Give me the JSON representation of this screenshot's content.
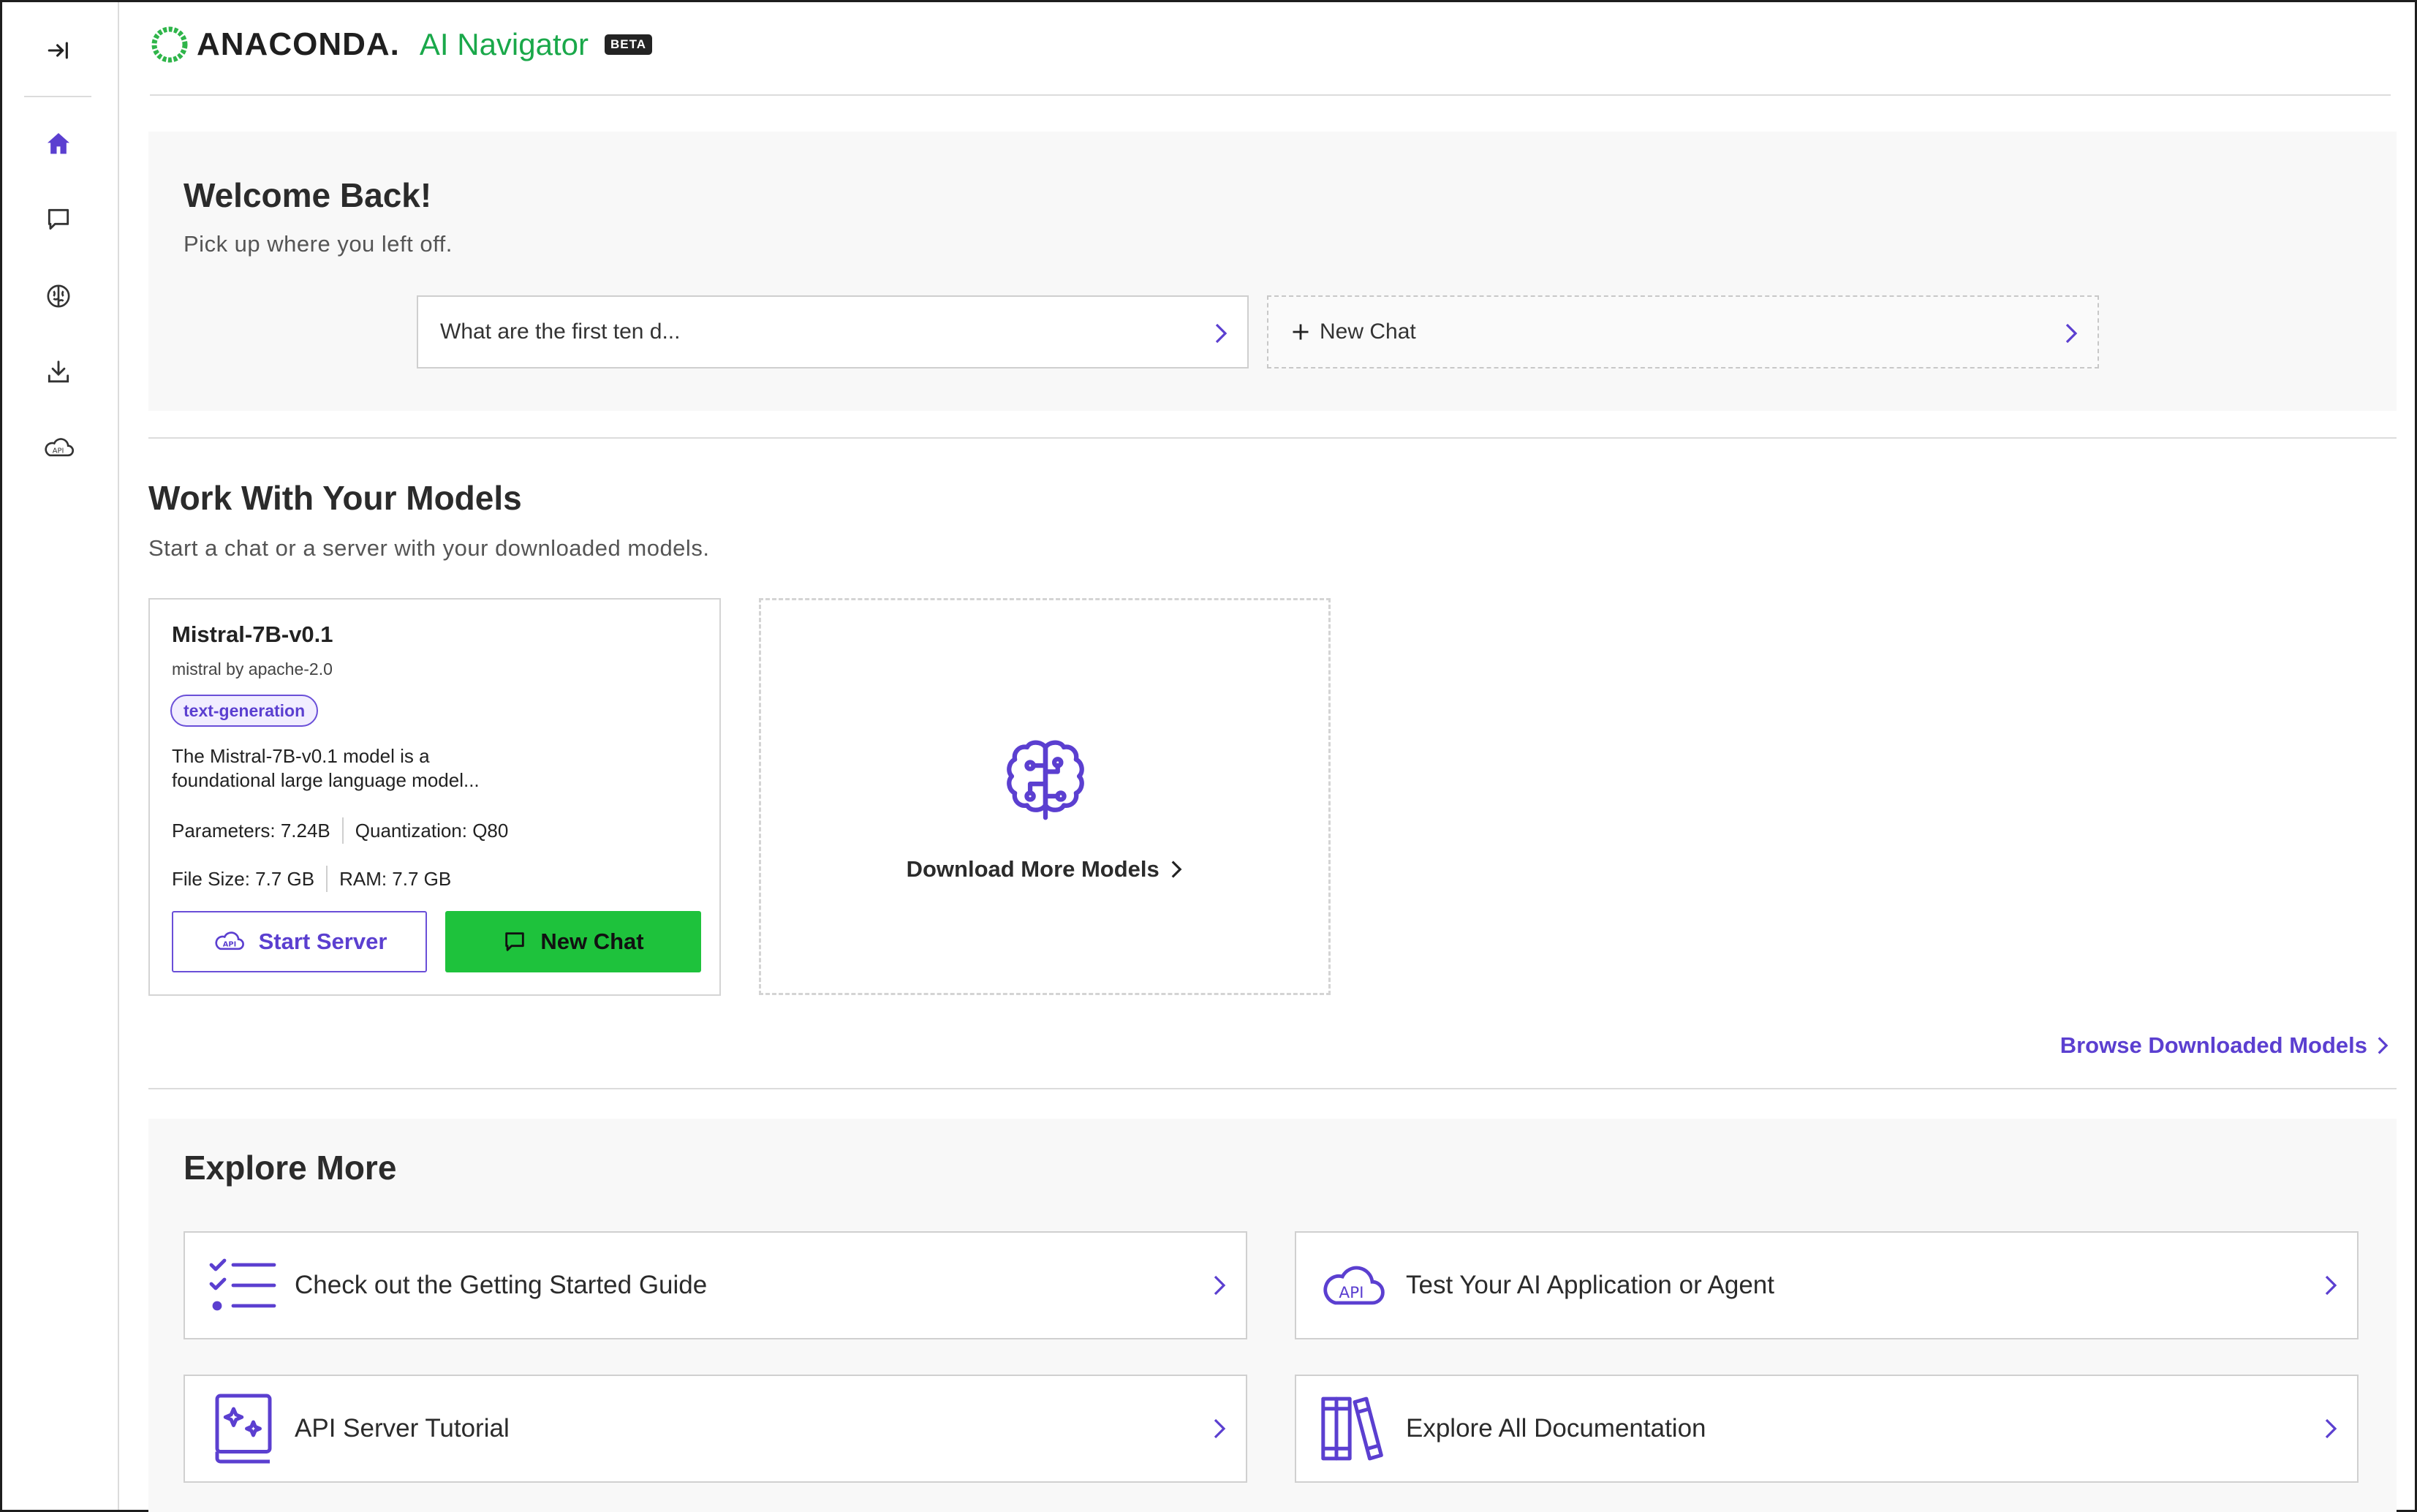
{
  "app": {
    "brand": "ANACONDA",
    "brand_dot": ".",
    "product": "AI Navigator",
    "badge": "BETA"
  },
  "colors": {
    "brand_green": "#1aa84a",
    "accent_purple": "#5b3fd0",
    "button_green": "#1ec23c"
  },
  "sidebar": {
    "items": [
      {
        "icon": "collapse-icon"
      },
      {
        "icon": "home-icon"
      },
      {
        "icon": "chat-icon"
      },
      {
        "icon": "brain-icon"
      },
      {
        "icon": "download-icon"
      },
      {
        "icon": "api-cloud-icon"
      }
    ]
  },
  "welcome": {
    "title": "Welcome Back!",
    "subtitle": "Pick up where you left off.",
    "recent_chat": "What are the first ten d...",
    "new_chat": "New Chat"
  },
  "models": {
    "title": "Work With Your Models",
    "subtitle": "Start a chat or a server with your downloaded models.",
    "card": {
      "name": "Mistral-7B-v0.1",
      "by": "mistral by apache-2.0",
      "tag": "text-generation",
      "description": "The Mistral-7B-v0.1 model is a foundational large language model...",
      "parameters": "Parameters: 7.24B",
      "quantization": "Quantization: Q80",
      "file_size": "File Size: 7.7 GB",
      "ram": "RAM: 7.7 GB",
      "start_server": "Start Server",
      "new_chat": "New Chat"
    },
    "download_more": "Download More Models",
    "browse": "Browse Downloaded Models"
  },
  "explore": {
    "title": "Explore More",
    "items": [
      {
        "label": "Check out the Getting Started Guide",
        "icon": "checklist-icon"
      },
      {
        "label": "Test Your AI Application or Agent",
        "icon": "api-cloud-icon"
      },
      {
        "label": "API Server Tutorial",
        "icon": "tutorial-book-icon"
      },
      {
        "label": "Explore All Documentation",
        "icon": "books-icon"
      }
    ]
  }
}
